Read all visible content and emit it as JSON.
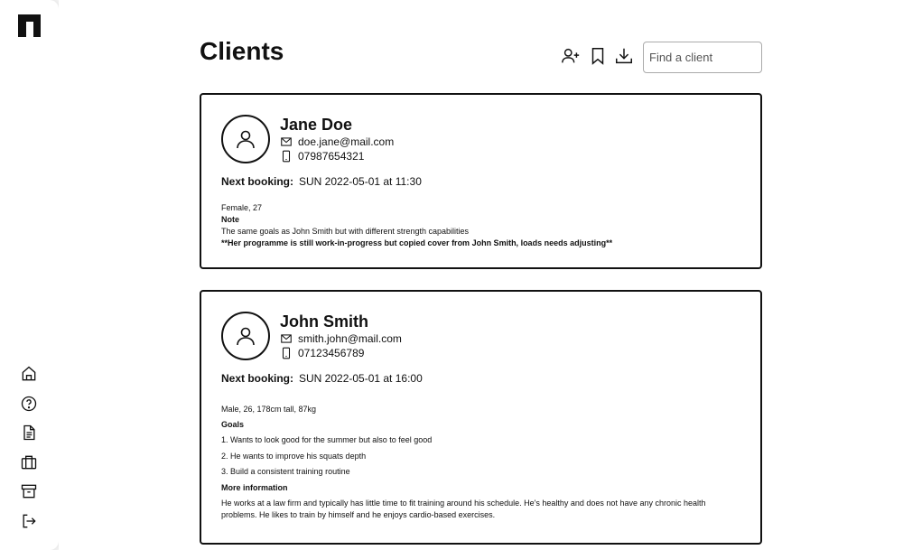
{
  "sidebar": {
    "logo": "app-logo",
    "items": [
      {
        "icon": "home-icon"
      },
      {
        "icon": "help-icon"
      },
      {
        "icon": "document-icon"
      },
      {
        "icon": "briefcase-icon"
      },
      {
        "icon": "archive-icon"
      },
      {
        "icon": "logout-icon"
      }
    ]
  },
  "header": {
    "title": "Clients",
    "search_placeholder": "Find a client",
    "actions": [
      "add-user-icon",
      "bookmark-icon",
      "download-icon"
    ]
  },
  "clients": [
    {
      "name": "Jane Doe",
      "email": "doe.jane@mail.com",
      "phone": "07987654321",
      "booking_label": "Next booking:",
      "booking_value": "SUN 2022-05-01 at 11:30",
      "details": "Female, 27",
      "note_heading": "Note",
      "note_text": "The same goals as John Smith but with different strength capabilities",
      "note_bold": "**Her programme is still work-in-progress but copied cover from John Smith, loads needs adjusting**"
    },
    {
      "name": "John Smith",
      "email": "smith.john@mail.com",
      "phone": "07123456789",
      "booking_label": "Next booking:",
      "booking_value": "SUN 2022-05-01 at 16:00",
      "details": "Male, 26, 178cm tall, 87kg",
      "goals_heading": "Goals",
      "goals": [
        "1. Wants to look good for the summer but also to feel good",
        "2. He wants to improve his squats depth",
        "3. Build a consistent training routine"
      ],
      "more_heading": "More information",
      "more_text": "He works at a law firm and typically has little time to fit training around his schedule. He's healthy and does not have any chronic health problems. He likes to train by himself and he enjoys cardio-based exercises."
    }
  ]
}
